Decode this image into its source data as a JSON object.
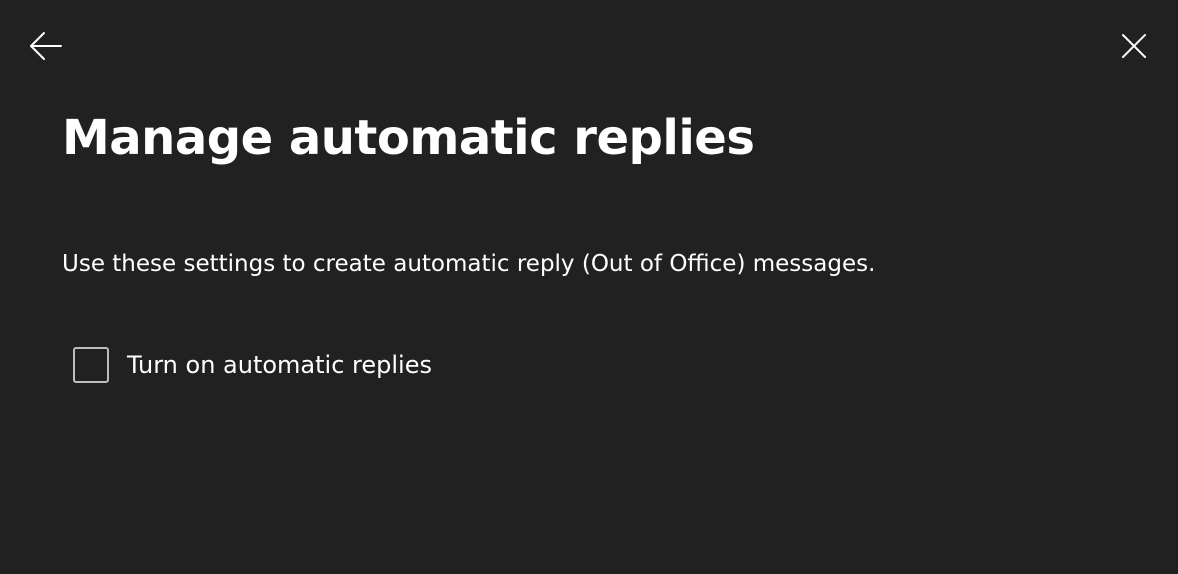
{
  "header": {
    "back_icon": "arrow-left-icon",
    "close_icon": "close-icon"
  },
  "main": {
    "title": "Manage automatic replies",
    "description": "Use these settings to create automatic reply (Out of Office) messages.",
    "auto_reply_checkbox": {
      "label": "Turn on automatic replies",
      "checked": false
    }
  },
  "colors": {
    "background": "#212121",
    "text": "#ffffff",
    "checkbox_border": "#bdbdbd"
  }
}
